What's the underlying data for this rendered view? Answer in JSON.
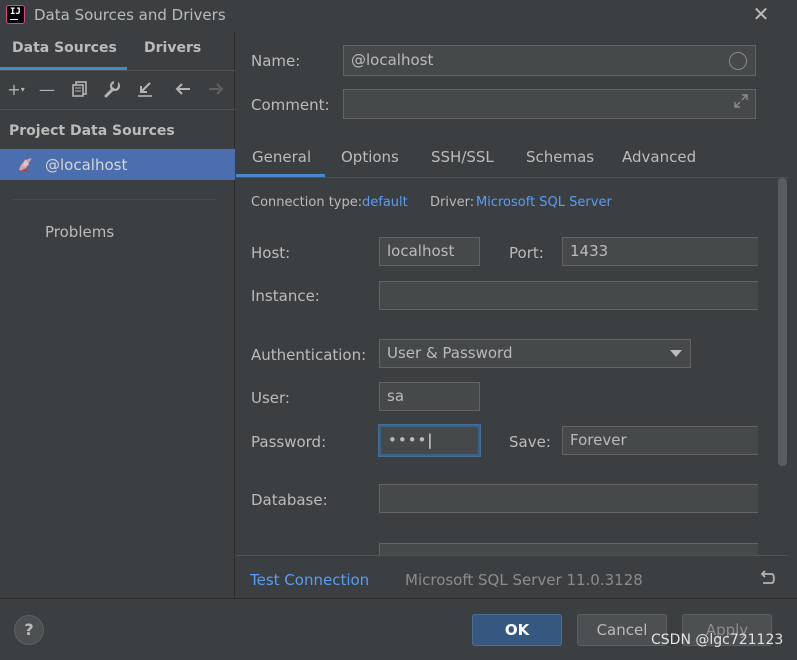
{
  "window": {
    "title": "Data Sources and Drivers"
  },
  "left": {
    "tabs": [
      "Data Sources",
      "Drivers"
    ],
    "section_label": "Project Data Sources",
    "datasource": "@localhost",
    "problems_label": "Problems"
  },
  "form": {
    "name_label": "Name:",
    "name_value": "@localhost",
    "comment_label": "Comment:",
    "comment_value": "",
    "tabs": [
      "General",
      "Options",
      "SSH/SSL",
      "Schemas",
      "Advanced"
    ],
    "connection_type_label": "Connection type:",
    "connection_type_value": "default",
    "driver_label": "Driver:",
    "driver_value": "Microsoft SQL Server",
    "host_label": "Host:",
    "host_value": "localhost",
    "port_label": "Port:",
    "port_value": "1433",
    "instance_label": "Instance:",
    "instance_value": "",
    "auth_label": "Authentication:",
    "auth_value": "User & Password",
    "user_label": "User:",
    "user_value": "sa",
    "password_label": "Password:",
    "password_value": "••••",
    "save_label": "Save:",
    "save_value": "Forever",
    "database_label": "Database:",
    "database_value": ""
  },
  "test_strip": {
    "test_connection": "Test Connection",
    "server_version": "Microsoft SQL Server 11.0.3128"
  },
  "footer": {
    "help": "?",
    "ok": "OK",
    "cancel": "Cancel",
    "apply": "Apply"
  },
  "watermark": "CSDN @lgc721123",
  "colors": {
    "accent": "#4a88c7",
    "link": "#589df6",
    "selection": "#4b6eaf",
    "ok_button": "#365880"
  }
}
